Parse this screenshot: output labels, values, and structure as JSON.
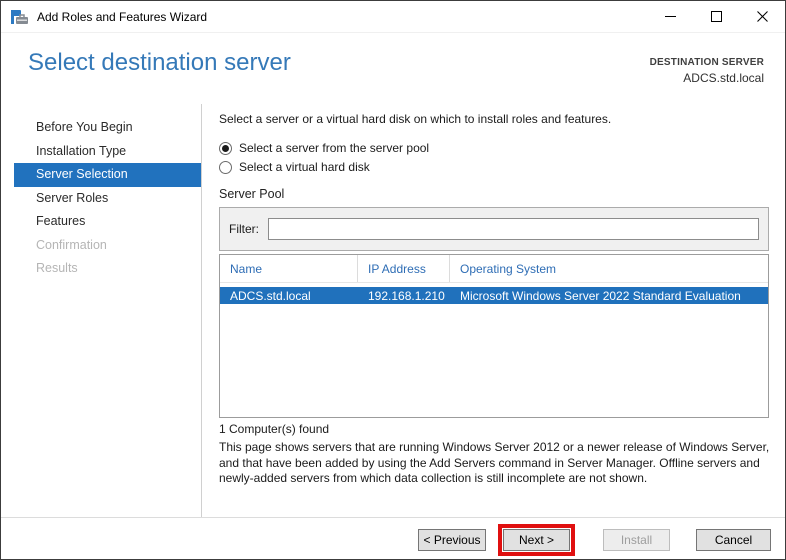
{
  "window": {
    "title": "Add Roles and Features Wizard"
  },
  "header": {
    "page_title": "Select destination server",
    "destination": {
      "label": "DESTINATION SERVER",
      "server": "ADCS.std.local"
    }
  },
  "sidebar": {
    "items": [
      {
        "label": "Before You Begin",
        "state": "enabled"
      },
      {
        "label": "Installation Type",
        "state": "enabled"
      },
      {
        "label": "Server Selection",
        "state": "selected"
      },
      {
        "label": "Server Roles",
        "state": "enabled"
      },
      {
        "label": "Features",
        "state": "enabled"
      },
      {
        "label": "Confirmation",
        "state": "disabled"
      },
      {
        "label": "Results",
        "state": "disabled"
      }
    ]
  },
  "main": {
    "intro": "Select a server or a virtual hard disk on which to install roles and features.",
    "radio_options": [
      {
        "label": "Select a server from the server pool",
        "selected": true
      },
      {
        "label": "Select a virtual hard disk",
        "selected": false
      }
    ],
    "server_pool": {
      "section_title": "Server Pool",
      "filter_label": "Filter:",
      "filter_value": "",
      "table": {
        "columns": [
          "Name",
          "IP Address",
          "Operating System"
        ],
        "rows": [
          {
            "name": "ADCS.std.local",
            "ip_address": "192.168.1.210",
            "operating_system": "Microsoft Windows Server 2022 Standard Evaluation",
            "selected": true
          }
        ]
      },
      "found_text": "1 Computer(s) found"
    },
    "description": "This page shows servers that are running Windows Server 2012 or a newer release of Windows Server, and that have been added by using the Add Servers command in Server Manager. Offline servers and newly-added servers from which data collection is still incomplete are not shown."
  },
  "footer": {
    "buttons": [
      {
        "label": "< Previous",
        "enabled": true,
        "highlighted": false
      },
      {
        "label": "Next >",
        "enabled": true,
        "highlighted": true
      },
      {
        "label": "Install",
        "enabled": false,
        "highlighted": false
      },
      {
        "label": "Cancel",
        "enabled": true,
        "highlighted": false
      }
    ]
  },
  "colors": {
    "title_blue": "#3579b8",
    "nav_selected_blue": "#2172be",
    "row_selected_blue": "#2071bc",
    "column_header_blue": "#2e6db5",
    "annotation_red": "#e01010"
  },
  "icons": {
    "titlebar": "wizard-toolbox-icon",
    "window_controls": [
      "minimize-icon",
      "maximize-icon",
      "close-icon"
    ],
    "radio": [
      "radio-selected-icon",
      "radio-unselected-icon"
    ]
  }
}
